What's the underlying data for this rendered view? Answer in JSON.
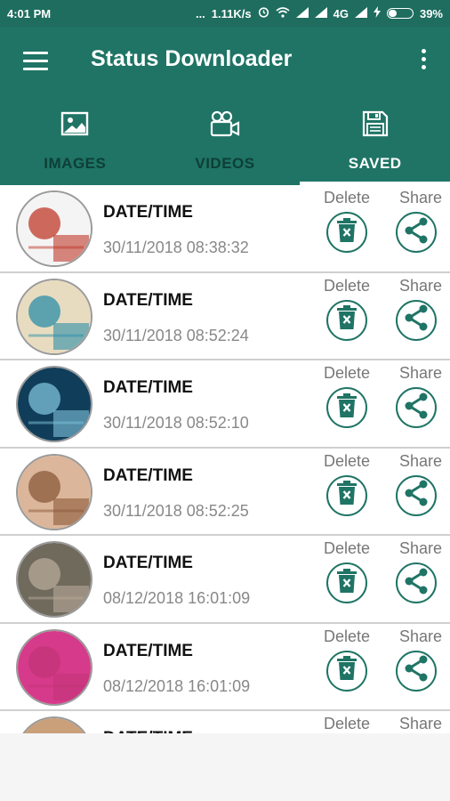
{
  "status_bar": {
    "time": "4:01 PM",
    "dots": "...",
    "speed": "1.11K/s",
    "network": "4G",
    "battery": "39%"
  },
  "app_bar": {
    "title": "Status Downloader"
  },
  "tabs": [
    {
      "label": "IMAGES",
      "icon": "image-icon",
      "active": false
    },
    {
      "label": "VIDEOS",
      "icon": "video-camera-icon",
      "active": false
    },
    {
      "label": "SAVED",
      "icon": "save-icon",
      "active": true
    }
  ],
  "list": {
    "delete_label": "Delete",
    "share_label": "Share",
    "items": [
      {
        "title": "DATE/TIME",
        "datetime": "30/11/2018 08:38:32",
        "thumb_colors": [
          "#f4f4f4",
          "#c0392b"
        ]
      },
      {
        "title": "DATE/TIME",
        "datetime": "30/11/2018 08:52:24",
        "thumb_colors": [
          "#e8dcc0",
          "#2d8fa8"
        ]
      },
      {
        "title": "DATE/TIME",
        "datetime": "30/11/2018 08:52:10",
        "thumb_colors": [
          "#103e5a",
          "#7ec2d9"
        ]
      },
      {
        "title": "DATE/TIME",
        "datetime": "30/11/2018 08:52:25",
        "thumb_colors": [
          "#dcb69a",
          "#8a5a3a"
        ]
      },
      {
        "title": "DATE/TIME",
        "datetime": "08/12/2018 16:01:09",
        "thumb_colors": [
          "#6f6a5c",
          "#b7a99a"
        ]
      },
      {
        "title": "DATE/TIME",
        "datetime": "08/12/2018 16:01:09",
        "thumb_colors": [
          "#d63a8a",
          "#c23478"
        ]
      },
      {
        "title": "DATE/TIME",
        "datetime": "",
        "thumb_colors": [
          "#c9a07a",
          "#6b4a2e"
        ]
      }
    ]
  },
  "colors": {
    "primary": "#1f7465",
    "status_bar": "#1e6d5f",
    "inactive_tab_text": "#0d3f37",
    "accent_icon": "#1f7465"
  }
}
